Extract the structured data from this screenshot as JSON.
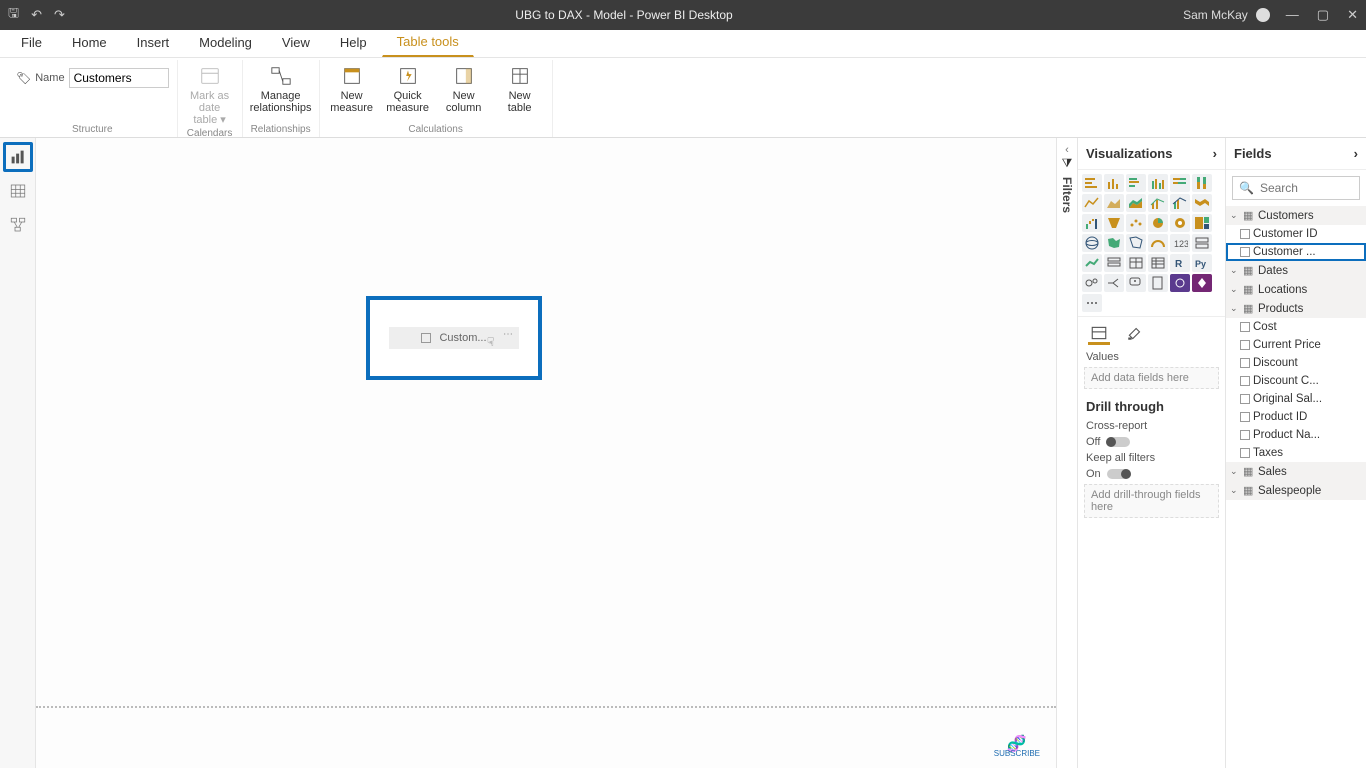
{
  "titlebar": {
    "title": "UBG to DAX - Model - Power BI Desktop",
    "user": "Sam McKay"
  },
  "ribbon_tabs": [
    "File",
    "Home",
    "Insert",
    "Modeling",
    "View",
    "Help",
    "Table tools"
  ],
  "ribbon_active_tab": "Table tools",
  "ribbon": {
    "name_label": "Name",
    "name_value": "Customers",
    "groups": {
      "structure": "Structure",
      "calendars": "Calendars",
      "relationships": "Relationships",
      "calculations": "Calculations"
    },
    "buttons": {
      "mark_date": "Mark as date table ▾",
      "manage_rel": "Manage relationships",
      "new_measure": "New measure",
      "quick_measure": "Quick measure",
      "new_column": "New column",
      "new_table": "New table"
    }
  },
  "leftnav": [
    "report",
    "data",
    "model"
  ],
  "canvas_visual": {
    "label": "Custom..."
  },
  "filters_label": "Filters",
  "visualizations": {
    "title": "Visualizations",
    "values_label": "Values",
    "values_placeholder": "Add data fields here",
    "drill_title": "Drill through",
    "cross_report_label": "Cross-report",
    "cross_report_state": "Off",
    "keep_filters_label": "Keep all filters",
    "keep_filters_state": "On",
    "drill_placeholder": "Add drill-through fields here"
  },
  "fields": {
    "title": "Fields",
    "search_placeholder": "Search",
    "tables": [
      {
        "name": "Customers",
        "open": true,
        "fields": [
          "Customer ID",
          "Customer ..."
        ]
      },
      {
        "name": "Dates",
        "open": false,
        "fields": []
      },
      {
        "name": "Locations",
        "open": false,
        "fields": []
      },
      {
        "name": "Products",
        "open": true,
        "fields": [
          "Cost",
          "Current Price",
          "Discount",
          "Discount C...",
          "Original Sal...",
          "Product ID",
          "Product Na...",
          "Taxes"
        ]
      },
      {
        "name": "Sales",
        "open": false,
        "fields": []
      },
      {
        "name": "Salespeople",
        "open": false,
        "fields": []
      }
    ],
    "selected_field": "Customer ..."
  },
  "subscribe": "SUBSCRIBE"
}
